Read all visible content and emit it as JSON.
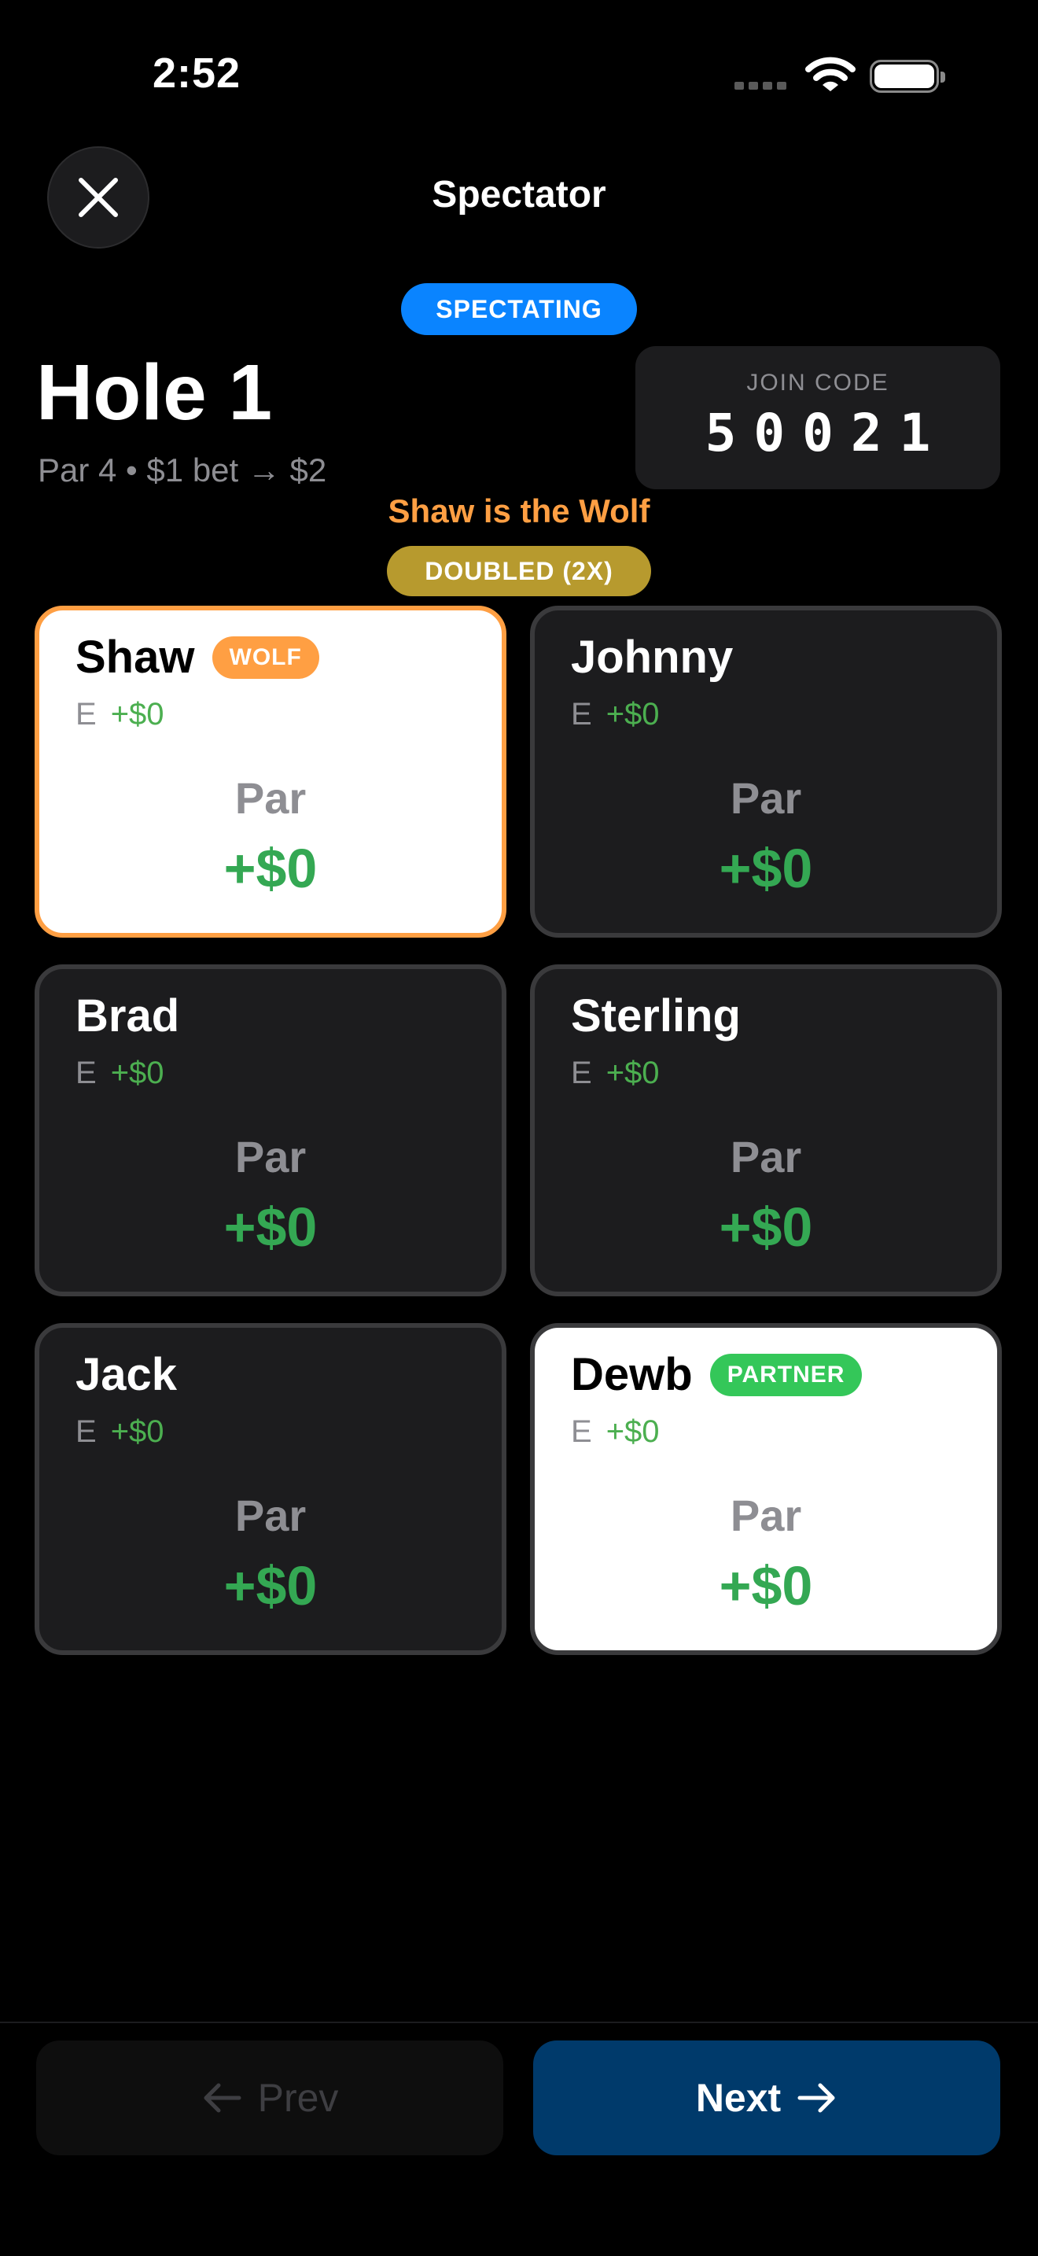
{
  "status_bar": {
    "time": "2:52"
  },
  "nav": {
    "title": "Spectator"
  },
  "mode_badge": "SPECTATING",
  "hole": {
    "title": "Hole 1",
    "subtitle": "Par 4 • $1 bet → $2"
  },
  "join": {
    "label": "JOIN CODE",
    "code": "50021"
  },
  "wolf_line": "Shaw is the Wolf",
  "multiplier_badge": "DOUBLED (2X)",
  "players": [
    {
      "name": "Shaw",
      "badge": "WOLF",
      "total_score": "E",
      "total_money": "+$0",
      "hole_result": "Par",
      "hole_money": "+$0"
    },
    {
      "name": "Johnny",
      "badge": "",
      "total_score": "E",
      "total_money": "+$0",
      "hole_result": "Par",
      "hole_money": "+$0"
    },
    {
      "name": "Brad",
      "badge": "",
      "total_score": "E",
      "total_money": "+$0",
      "hole_result": "Par",
      "hole_money": "+$0"
    },
    {
      "name": "Sterling",
      "badge": "",
      "total_score": "E",
      "total_money": "+$0",
      "hole_result": "Par",
      "hole_money": "+$0"
    },
    {
      "name": "Jack",
      "badge": "",
      "total_score": "E",
      "total_money": "+$0",
      "hole_result": "Par",
      "hole_money": "+$0"
    },
    {
      "name": "Dewb",
      "badge": "PARTNER",
      "total_score": "E",
      "total_money": "+$0",
      "hole_result": "Par",
      "hole_money": "+$0"
    }
  ],
  "footer": {
    "prev_label": "Prev",
    "next_label": "Next"
  },
  "colors": {
    "accent_blue": "#0a84ff",
    "wolf_orange": "#ff9f43",
    "partner_green": "#34c759",
    "money_green": "#34a853",
    "doubled_gold": "#b79a2e"
  },
  "icons": {
    "close": "close-icon",
    "prev": "arrow-left-icon",
    "next": "arrow-right-icon"
  }
}
